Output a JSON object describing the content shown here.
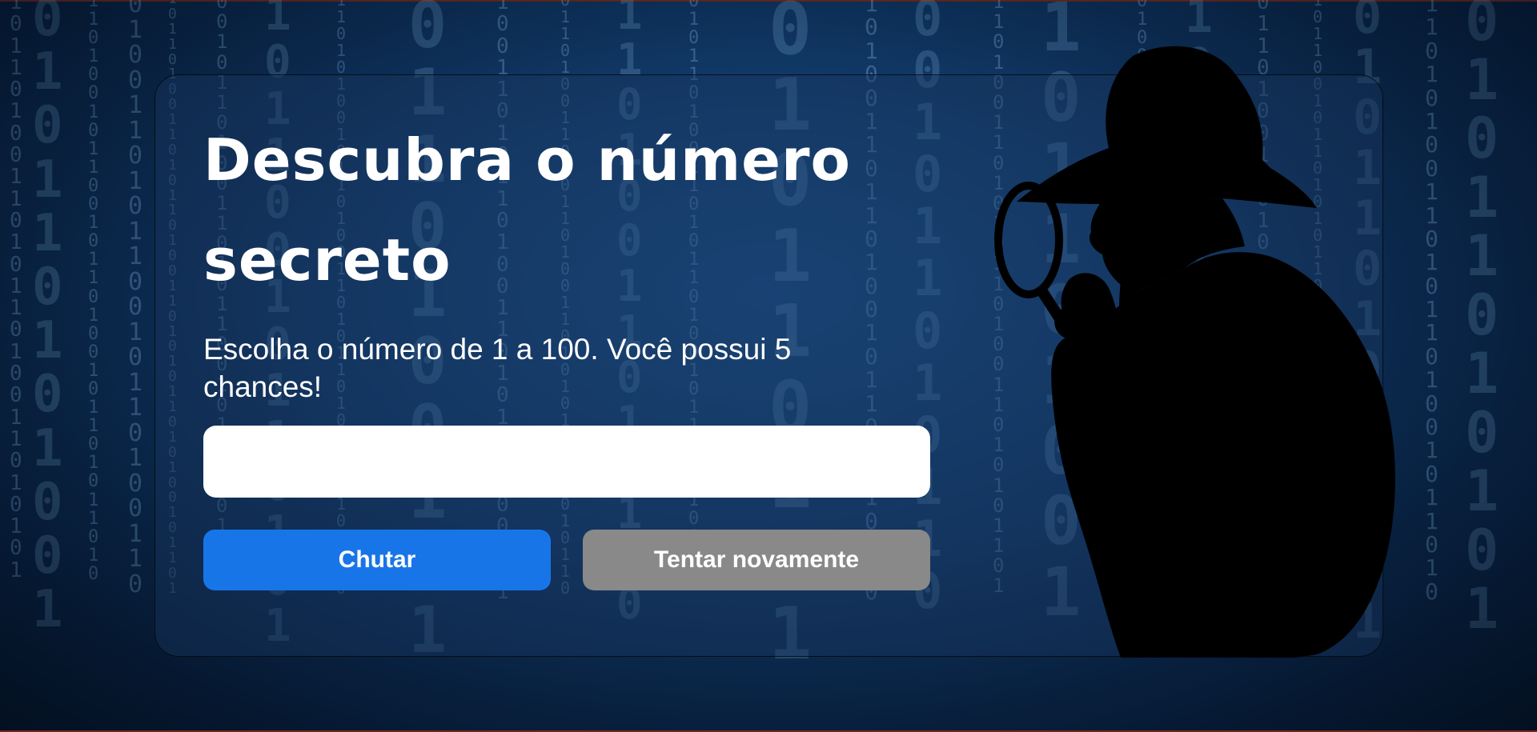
{
  "page": {
    "title": "Descubra o número secreto",
    "instructions": "Escolha o número de 1 a 100. Você possui 5 chances!"
  },
  "guess_input": {
    "value": "",
    "placeholder": ""
  },
  "buttons": {
    "guess_label": "Chutar",
    "restart_label": "Tentar novamente"
  },
  "illustration": {
    "icon": "detective-silhouette-with-magnifying-glass"
  },
  "background": {
    "icon": "binary-matrix-code"
  },
  "colors": {
    "primary_button": "#1875e8",
    "secondary_button": "#898989",
    "background": "#0f3561",
    "text": "#ffffff"
  }
}
